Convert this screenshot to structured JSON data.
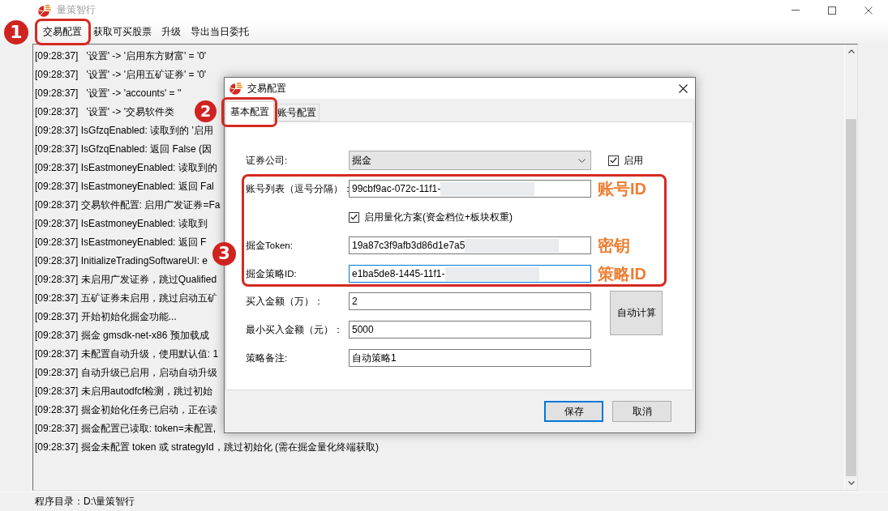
{
  "window": {
    "title": "量策智行"
  },
  "menu": {
    "badge": "1",
    "items": [
      {
        "label": "交易配置",
        "annotated": true
      },
      {
        "label": "获取可买股票",
        "annotated": false
      },
      {
        "label": "升级",
        "annotated": false
      },
      {
        "label": "导出当日委托",
        "annotated": false
      }
    ]
  },
  "log": {
    "lines": [
      "[09:28:37]   '设置' -> '启用东方财富' = '0'",
      "[09:28:37]   '设置' -> '启用五矿证券' = '0'",
      "[09:28:37]   '设置' -> 'accounts' = ''",
      "[09:28:37]   '设置' -> '交易软件类",
      "[09:28:37] IsGfzqEnabled: 读取到的 '启用",
      "[09:28:37] IsGfzqEnabled: 返回 False (因",
      "[09:28:37] IsEastmoneyEnabled: 读取到的",
      "[09:28:37] IsEastmoneyEnabled: 返回 Fal",
      "[09:28:37] 交易软件配置: 启用广发证券=Fa",
      "[09:28:37] IsEastmoneyEnabled: 读取到",
      "[09:28:37] IsEastmoneyEnabled: 返回 F",
      "[09:28:37] InitializeTradingSoftwareUI: e",
      "[09:28:37] 未启用广发证券，跳过Qualified",
      "[09:28:37] 五矿证券未启用，跳过启动五矿",
      "[09:28:37] 开始初始化掘金功能...",
      "[09:28:37] 掘金 gmsdk-net-x86 预加载成",
      "[09:28:37] 未配置自动升级，使用默认值: 1",
      "[09:28:37] 自动升级已启用，启动自动升级",
      "[09:28:37] 未启用autodfcf检测，跳过初始",
      "[09:28:37] 掘金初始化任务已启动，正在读",
      "[09:28:37] 掘金配置已读取: token=未配置,",
      "[09:28:37] 掘金未配置 token 或 strategyId，跳过初始化 (需在掘金量化终端获取)"
    ]
  },
  "status_bar": {
    "text": "程序目录：D:\\量策智行"
  },
  "dialog": {
    "title": "交易配置",
    "tabs_badge": "2",
    "tabs": [
      {
        "label": "基本配置",
        "selected": true,
        "annotated": true
      },
      {
        "label": "账号配置",
        "selected": false,
        "annotated": false
      }
    ],
    "sections": [
      {
        "highlighted": false,
        "rows": [
          {
            "kind": "select",
            "label": "证券公司:",
            "value": "掘金",
            "toggle": {
              "label": "启用",
              "checked": true
            }
          }
        ]
      },
      {
        "highlighted": true,
        "badge": "3",
        "rows": [
          {
            "kind": "text",
            "label": "账号列表（逗号分隔）：",
            "value": "99cbf9ac-072c-11f1-",
            "redacted": true,
            "focused": false,
            "note": "账号ID"
          },
          {
            "kind": "checkbox",
            "label": "启用量化方案(资金档位+板块权重)",
            "checked": true
          },
          {
            "kind": "text",
            "label": "掘金Token:",
            "value": "19a87c3f9afb3d86d1e7a5",
            "redacted": true,
            "focused": false,
            "note": "密钥"
          },
          {
            "kind": "text",
            "label": "掘金策略ID:",
            "value": "e1ba5de8-1445-11f1-",
            "redacted": true,
            "focused": true,
            "note": "策略ID"
          }
        ]
      },
      {
        "highlighted": false,
        "side_button": "自动计算",
        "rows": [
          {
            "kind": "text",
            "label": "买入金额（万）：",
            "value": "2",
            "redacted": false,
            "focused": false
          },
          {
            "kind": "text",
            "label": "最小买入金额（元）：",
            "value": "5000",
            "redacted": false,
            "focused": false
          },
          {
            "kind": "text",
            "label": "策略备注:",
            "value": "自动策略1",
            "redacted": false,
            "focused": false
          }
        ]
      }
    ],
    "buttons": [
      {
        "label": "保存",
        "default": true
      },
      {
        "label": "取消",
        "default": false
      }
    ]
  }
}
